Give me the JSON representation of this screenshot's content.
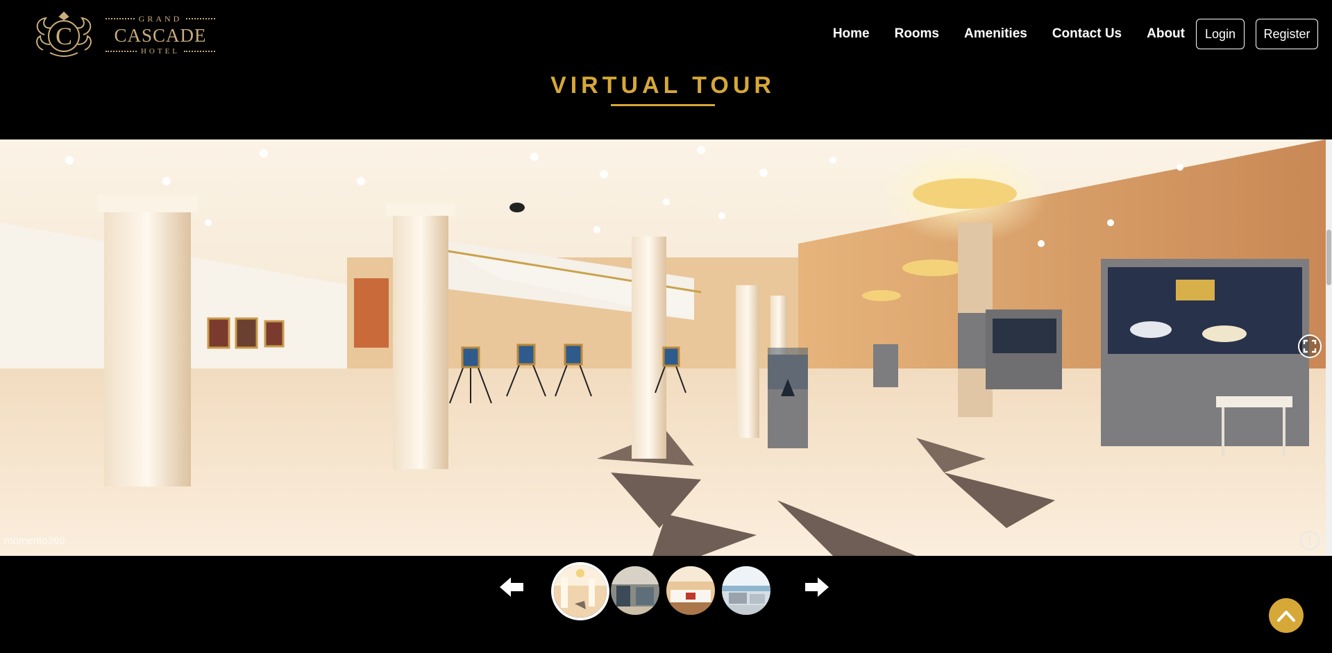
{
  "brand": {
    "top": "GRAND",
    "name": "CASCADE",
    "bottom": "HOTEL",
    "monogram": "C"
  },
  "nav": {
    "links": [
      "Home",
      "Rooms",
      "Amenities",
      "Contact Us",
      "About"
    ],
    "login": "Login",
    "register": "Register"
  },
  "section": {
    "title": "VIRTUAL TOUR"
  },
  "viewer": {
    "watermark": "momento360",
    "info_glyph": "i",
    "icons": [
      "fullscreen-icon",
      "info-icon"
    ]
  },
  "carousel": {
    "thumbnails": [
      "Lobby hall",
      "Dining area",
      "Bedroom",
      "Terrace"
    ],
    "active_index": 0,
    "icons": [
      "arrow-left-icon",
      "arrow-right-icon"
    ]
  },
  "colors": {
    "accent": "#d6a838",
    "logo": "#c9ad7c",
    "background": "#000000"
  }
}
